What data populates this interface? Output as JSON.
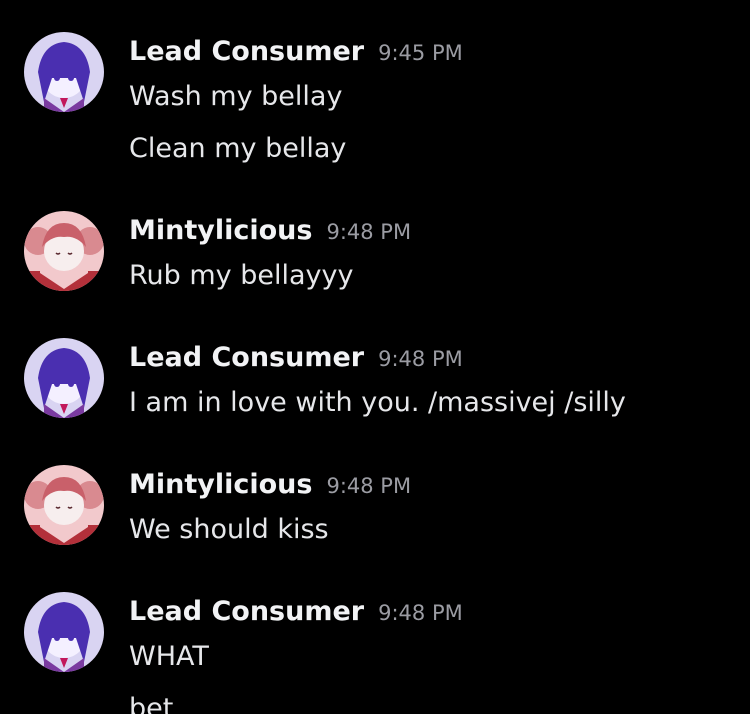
{
  "colors": {
    "background": "#000000",
    "username": "#f2f3f5",
    "timestamp": "#9b9ca3",
    "message_text": "#e6e7ea",
    "lead_avatar_bg": "#d9d4f2",
    "lead_avatar_accent": "#4a2fb0",
    "minty_avatar_bg": "#f2c9cc",
    "minty_avatar_accent": "#b3303a"
  },
  "messages": [
    {
      "author": "Lead Consumer",
      "time": "9:45 PM",
      "avatar": "lead-consumer-avatar",
      "lines": [
        "Wash my bellay",
        "Clean my bellay"
      ]
    },
    {
      "author": "Mintylicious",
      "time": "9:48 PM",
      "avatar": "mintylicious-avatar",
      "lines": [
        "Rub my bellayyy"
      ]
    },
    {
      "author": "Lead Consumer",
      "time": "9:48 PM",
      "avatar": "lead-consumer-avatar",
      "lines": [
        "I am in love with you. /massivej /silly"
      ]
    },
    {
      "author": "Mintylicious",
      "time": "9:48 PM",
      "avatar": "mintylicious-avatar",
      "lines": [
        "We should kiss"
      ]
    },
    {
      "author": "Lead Consumer",
      "time": "9:48 PM",
      "avatar": "lead-consumer-avatar",
      "lines": [
        "WHAT",
        "bet"
      ]
    }
  ]
}
